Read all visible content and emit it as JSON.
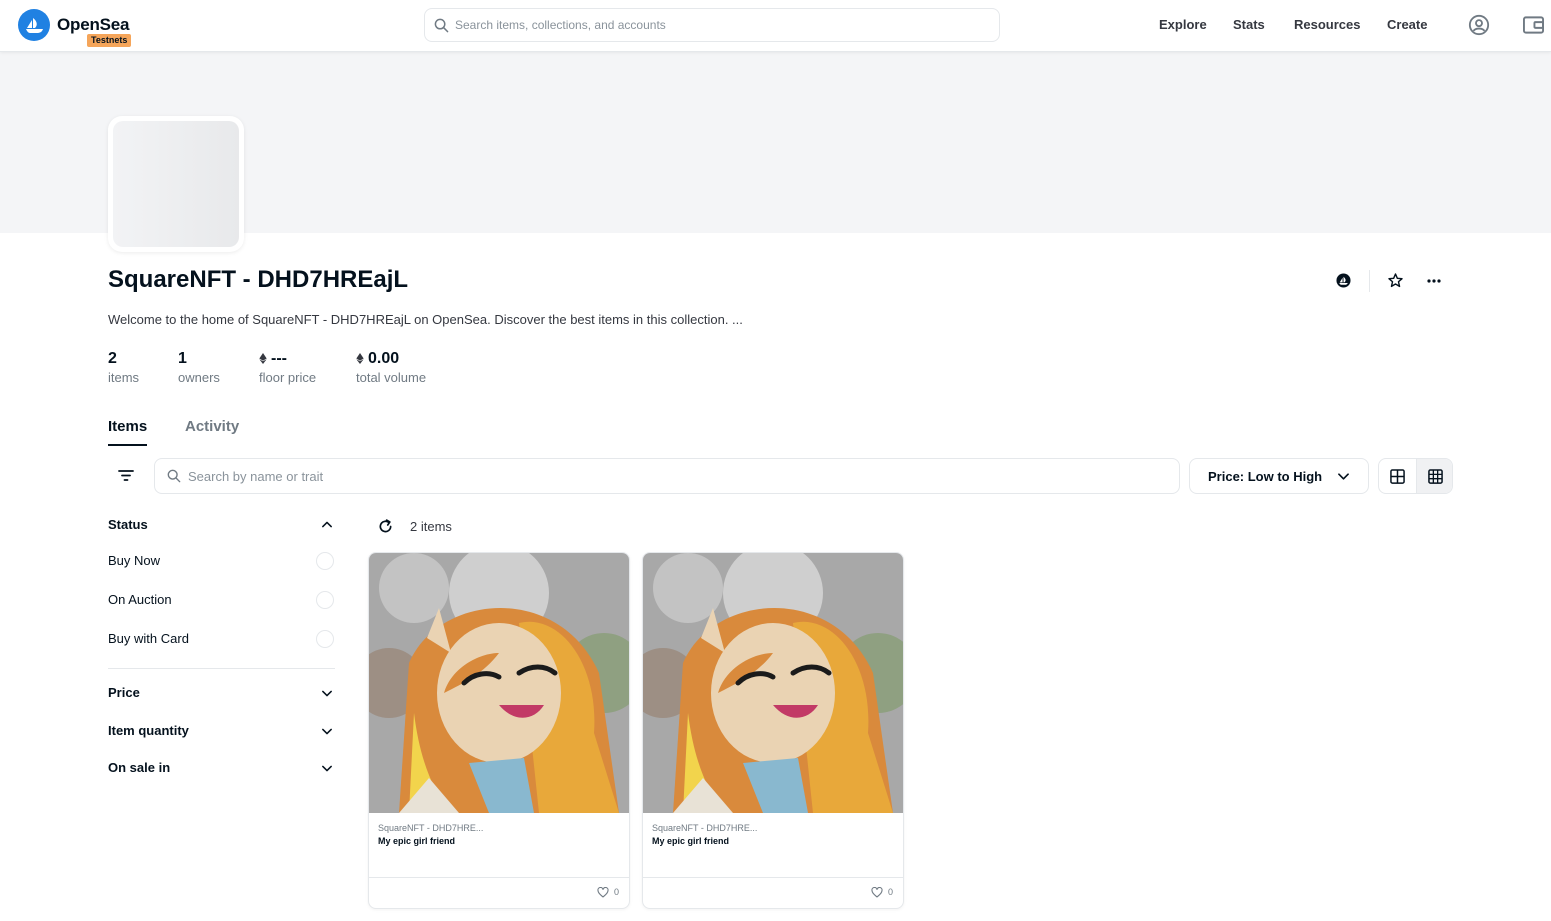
{
  "header": {
    "brand": "OpenSea",
    "badge": "Testnets",
    "search_placeholder": "Search items, collections, and accounts",
    "nav": [
      "Explore",
      "Stats",
      "Resources",
      "Create"
    ]
  },
  "collection": {
    "title": "SquareNFT - DHD7HREajL",
    "description": "Welcome to the home of SquareNFT - DHD7HREajL on OpenSea. Discover the best items in this collection. ...",
    "stats": [
      {
        "value": "2",
        "label": "items",
        "eth": false
      },
      {
        "value": "1",
        "label": "owners",
        "eth": false
      },
      {
        "value": "---",
        "label": "floor price",
        "eth": true
      },
      {
        "value": "0.00",
        "label": "total volume",
        "eth": true
      }
    ]
  },
  "tabs": [
    "Items",
    "Activity"
  ],
  "toolbar": {
    "search_placeholder": "Search by name or trait",
    "sort": "Price: Low to High"
  },
  "sidebar": {
    "status": {
      "title": "Status",
      "options": [
        "Buy Now",
        "On Auction",
        "Buy with Card"
      ]
    },
    "sections": [
      "Price",
      "Item quantity",
      "On sale in"
    ]
  },
  "results": {
    "count": "2 items"
  },
  "items": [
    {
      "collection": "SquareNFT - DHD7HRE...",
      "name": "My epic girl friend",
      "favorites": "0"
    },
    {
      "collection": "SquareNFT - DHD7HRE...",
      "name": "My epic girl friend",
      "favorites": "0"
    }
  ],
  "colors": {
    "brand": "#2081e2",
    "badge": "#f5a55a",
    "text": "#04111d",
    "muted": "#707a83",
    "border": "#e5e8eb"
  }
}
